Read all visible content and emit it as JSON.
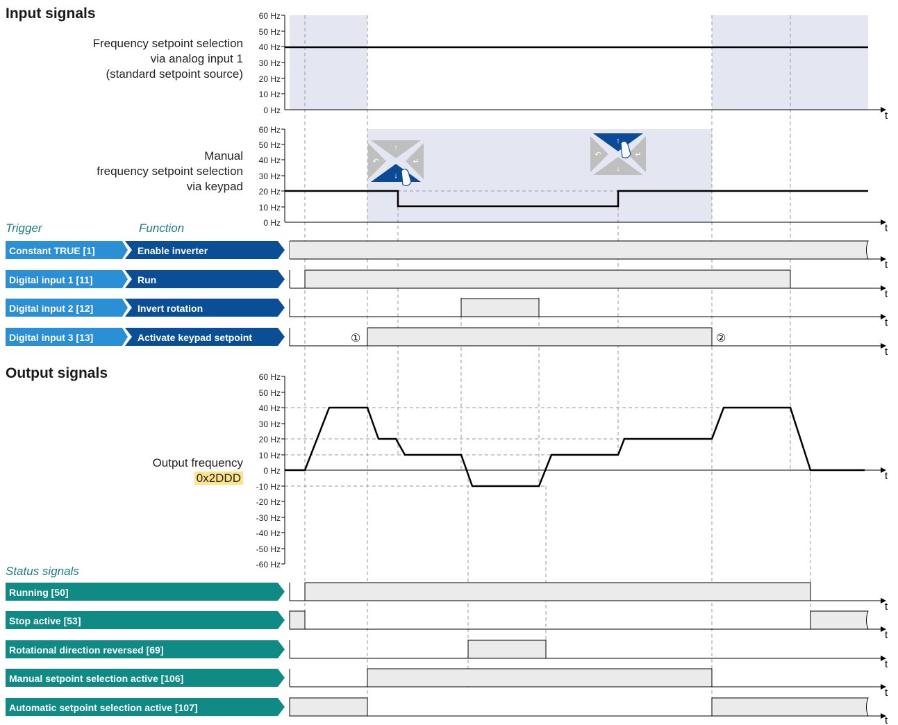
{
  "sections": {
    "input_title": "Input signals",
    "output_title": "Output signals",
    "trigger_header": "Trigger",
    "function_header": "Function",
    "status_header": "Status signals"
  },
  "analog_plot": {
    "label_lines": [
      "Frequency setpoint selection",
      "via analog input 1",
      "(standard setpoint source)"
    ],
    "y_ticks": [
      "60 Hz",
      "50 Hz",
      "40 Hz",
      "30 Hz",
      "20 Hz",
      "10 Hz",
      "0 Hz"
    ]
  },
  "keypad_plot": {
    "label_lines": [
      "Manual",
      "frequency setpoint selection",
      "via keypad"
    ],
    "y_ticks": [
      "60 Hz",
      "50 Hz",
      "40 Hz",
      "30 Hz",
      "20 Hz",
      "10 Hz",
      "0 Hz"
    ]
  },
  "output_plot": {
    "label_lines": [
      "Output frequency"
    ],
    "param_code": "0x2DDD",
    "y_ticks": [
      "60 Hz",
      "50 Hz",
      "40 Hz",
      "30 Hz",
      "20 Hz",
      "10 Hz",
      "0 Hz",
      "-10 Hz",
      "-20 Hz",
      "-30 Hz",
      "-40 Hz",
      "-50 Hz",
      "-60 Hz"
    ]
  },
  "time_label": "t",
  "triggers": [
    {
      "trigger": "Constant TRUE [1]",
      "function": "Enable inverter"
    },
    {
      "trigger": "Digital input 1 [11]",
      "function": "Run"
    },
    {
      "trigger": "Digital input 2 [12]",
      "function": "Invert rotation"
    },
    {
      "trigger": "Digital input 3 [13]",
      "function": "Activate keypad setpoint"
    }
  ],
  "status_signals": [
    "Running [50]",
    "Stop active [53]",
    "Rotational direction reversed [69]",
    "Manual setpoint selection active [106]",
    "Automatic setpoint selection active [107]"
  ],
  "markers": [
    "①",
    "②"
  ],
  "colors": {
    "trigger_blue": "#0a4f96",
    "trigger_light_blue": "#2b8fd6",
    "status_teal": "#0f8a84",
    "bar_fill": "#ebebeb",
    "shade": "#e4e6f2",
    "keypad_blue": "#0b4a96",
    "keypad_grey": "#bfbfbf"
  },
  "icons": [
    "keypad-down-press-icon",
    "keypad-up-press-icon"
  ],
  "chart_data": {
    "type": "line",
    "xlabel": "t",
    "ylabel": "",
    "ylim": [
      -60,
      60
    ],
    "series": [
      {
        "name": "Frequency setpoint selection via analog input 1 (standard setpoint source)",
        "points": [
          [
            0,
            40
          ],
          [
            10,
            40
          ]
        ]
      },
      {
        "name": "Manual frequency setpoint selection via keypad",
        "points": [
          [
            0,
            20
          ],
          [
            3.3,
            20
          ],
          [
            3.3,
            10
          ],
          [
            6.4,
            10
          ],
          [
            6.4,
            20
          ],
          [
            10,
            20
          ]
        ]
      },
      {
        "name": "Output frequency",
        "points": [
          [
            0,
            0
          ],
          [
            0.5,
            0
          ],
          [
            1.0,
            40
          ],
          [
            1.7,
            40
          ],
          [
            2.0,
            20
          ],
          [
            2.3,
            20
          ],
          [
            2.5,
            10
          ],
          [
            3.3,
            10
          ],
          [
            3.6,
            -10
          ],
          [
            4.3,
            -10
          ],
          [
            4.6,
            10
          ],
          [
            5.7,
            10
          ],
          [
            5.9,
            20
          ],
          [
            6.7,
            20
          ],
          [
            7.0,
            40
          ],
          [
            7.8,
            40
          ],
          [
            8.2,
            0
          ],
          [
            9.0,
            0
          ]
        ]
      }
    ]
  }
}
